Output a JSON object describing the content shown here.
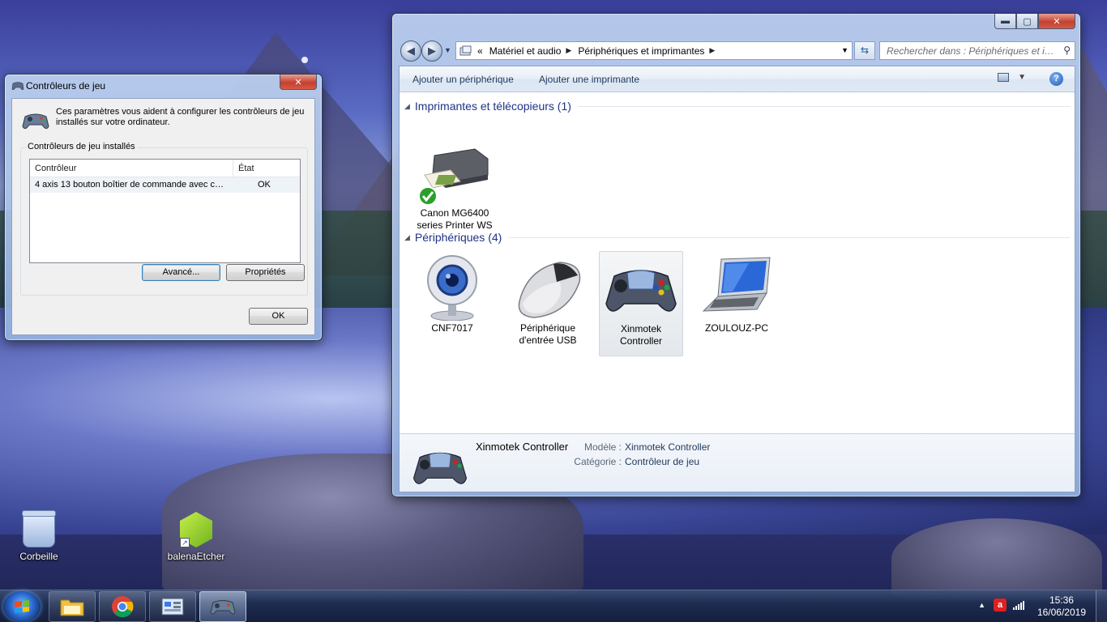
{
  "desktop": {
    "icons": [
      {
        "label": "Corbeille"
      },
      {
        "label": "balenaEtcher"
      }
    ]
  },
  "game_controllers": {
    "title": "Contrôleurs de jeu",
    "close_label": "✕",
    "intro": "Ces paramètres vous aident à configurer les contrôleurs de jeu installés sur votre ordinateur.",
    "group_title": "Contrôleurs de jeu installés",
    "columns": [
      "Contrôleur",
      "État"
    ],
    "rows": [
      {
        "controller": "4 axis 13 bouton boîtier de commande avec com...",
        "state": "OK"
      }
    ],
    "advanced_button": "Avancé...",
    "properties_button": "Propriétés",
    "ok_button": "OK"
  },
  "explorer": {
    "minimize": "▬",
    "maximize": "▢",
    "close": "✕",
    "breadcrumb_prefix": "«",
    "breadcrumb": [
      "Matériel et audio",
      "Périphériques et imprimantes"
    ],
    "search_placeholder": "Rechercher dans : Périphériques et im...",
    "commands": [
      "Ajouter un périphérique",
      "Ajouter une imprimante"
    ],
    "help": "?",
    "sections": [
      {
        "title": "Imprimantes et télécopieurs (1)"
      },
      {
        "title": "Périphériques (4)"
      }
    ],
    "printers": [
      {
        "label": "Canon MG6400 series Printer WS",
        "default": true
      }
    ],
    "devices": [
      {
        "label": "CNF7017"
      },
      {
        "label": "Périphérique d'entrée USB"
      },
      {
        "label": "Xinmotek Controller",
        "selected": true
      },
      {
        "label": "ZOULOUZ-PC"
      }
    ],
    "details": {
      "name": "Xinmotek Controller",
      "model_key": "Modèle :",
      "model_value": "Xinmotek Controller",
      "category_key": "Catégorie :",
      "category_value": "Contrôleur de jeu"
    }
  },
  "taskbar": {
    "time": "15:36",
    "date": "16/06/2019",
    "tray_arrow": "▲"
  }
}
